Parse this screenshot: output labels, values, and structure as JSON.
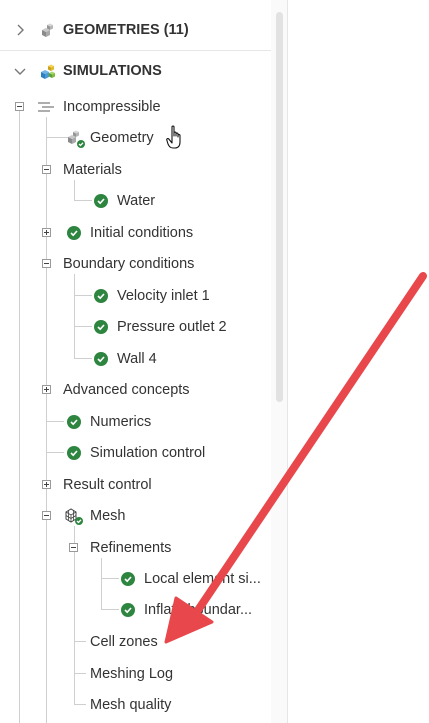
{
  "tree": {
    "geometries_header": {
      "label": "GEOMETRIES (11)",
      "icon": "geometries-cube-icon"
    },
    "simulations_header": {
      "label": "SIMULATIONS",
      "icon": "simulations-cube-icon"
    },
    "items": [
      {
        "label": "Incompressible",
        "icon": "simulation-type-icon"
      },
      {
        "label": "Geometry",
        "icon": "geometry-valid-icon"
      },
      {
        "label": "Materials"
      },
      {
        "label": "Water",
        "icon": "check-icon"
      },
      {
        "label": "Initial conditions",
        "icon": "check-icon"
      },
      {
        "label": "Boundary conditions"
      },
      {
        "label": "Velocity inlet 1",
        "icon": "check-icon"
      },
      {
        "label": "Pressure outlet 2",
        "icon": "check-icon"
      },
      {
        "label": "Wall 4",
        "icon": "check-icon"
      },
      {
        "label": "Advanced concepts"
      },
      {
        "label": "Numerics",
        "icon": "check-icon"
      },
      {
        "label": "Simulation control",
        "icon": "check-icon"
      },
      {
        "label": "Result control"
      },
      {
        "label": "Mesh",
        "icon": "mesh-valid-icon"
      },
      {
        "label": "Refinements"
      },
      {
        "label": "Local element si...",
        "icon": "check-icon"
      },
      {
        "label": "Inflate boundar...",
        "icon": "check-icon"
      },
      {
        "label": "Cell zones"
      },
      {
        "label": "Meshing Log"
      },
      {
        "label": "Mesh quality"
      }
    ]
  },
  "colors": {
    "check_green": "#2e8540",
    "annotation_arrow": "#e8474b",
    "tree_line": "#cfcfcf"
  }
}
